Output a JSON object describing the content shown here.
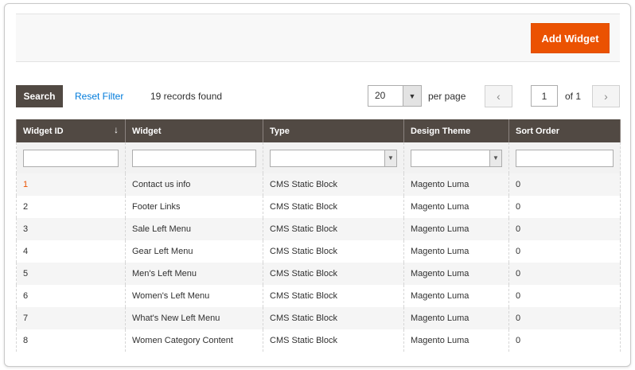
{
  "header": {
    "add_button": "Add Widget"
  },
  "toolbar": {
    "search_label": "Search",
    "reset_label": "Reset Filter",
    "records_text": "19 records found",
    "per_page_value": "20",
    "per_page_label": "per page",
    "page_value": "1",
    "page_of": "of 1",
    "prev_symbol": "‹",
    "next_symbol": "›"
  },
  "grid": {
    "columns": [
      "Widget ID",
      "Widget",
      "Type",
      "Design Theme",
      "Sort Order"
    ],
    "sort_symbol": "↓",
    "rows": [
      {
        "id": "1",
        "widget": "Contact us info",
        "type": "CMS Static Block",
        "theme": "Magento Luma",
        "sort": "0"
      },
      {
        "id": "2",
        "widget": "Footer Links",
        "type": "CMS Static Block",
        "theme": "Magento Luma",
        "sort": "0"
      },
      {
        "id": "3",
        "widget": "Sale Left Menu",
        "type": "CMS Static Block",
        "theme": "Magento Luma",
        "sort": "0"
      },
      {
        "id": "4",
        "widget": "Gear Left Menu",
        "type": "CMS Static Block",
        "theme": "Magento Luma",
        "sort": "0"
      },
      {
        "id": "5",
        "widget": "Men's Left Menu",
        "type": "CMS Static Block",
        "theme": "Magento Luma",
        "sort": "0"
      },
      {
        "id": "6",
        "widget": "Women's Left Menu",
        "type": "CMS Static Block",
        "theme": "Magento Luma",
        "sort": "0"
      },
      {
        "id": "7",
        "widget": "What's New Left Menu",
        "type": "CMS Static Block",
        "theme": "Magento Luma",
        "sort": "0"
      },
      {
        "id": "8",
        "widget": "Women Category Content",
        "type": "CMS Static Block",
        "theme": "Magento Luma",
        "sort": "0"
      }
    ]
  },
  "colors": {
    "accent": "#eb5202",
    "header_bg": "#514943",
    "link": "#007bdb"
  }
}
